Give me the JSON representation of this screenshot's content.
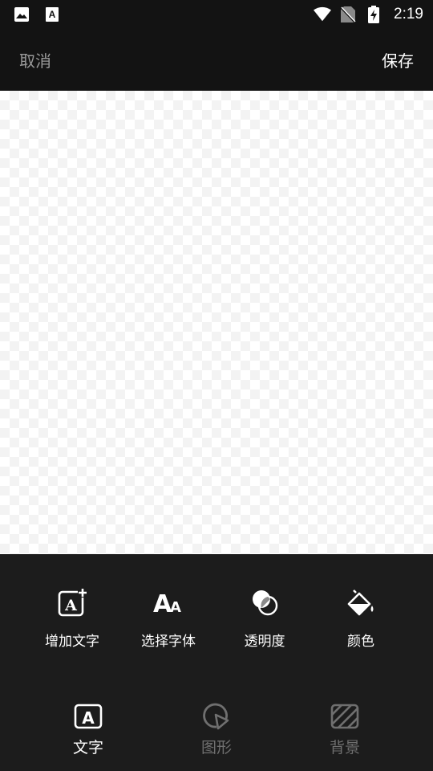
{
  "status_bar": {
    "time": "2:19",
    "icons": [
      "image-icon",
      "font-app-icon",
      "wifi-icon",
      "no-sim-icon",
      "battery-charging-icon"
    ]
  },
  "top_bar": {
    "cancel_label": "取消",
    "save_label": "保存"
  },
  "tools": [
    {
      "label": "增加文字",
      "icon": "add-text-icon"
    },
    {
      "label": "选择字体",
      "icon": "font-select-icon"
    },
    {
      "label": "透明度",
      "icon": "opacity-icon"
    },
    {
      "label": "颜色",
      "icon": "paint-bucket-icon"
    }
  ],
  "tabs": [
    {
      "label": "文字",
      "icon": "text-tab-icon",
      "active": true
    },
    {
      "label": "图形",
      "icon": "shape-tab-icon",
      "active": false
    },
    {
      "label": "背景",
      "icon": "background-tab-icon",
      "active": false
    }
  ],
  "colors": {
    "bar_background": "#131313",
    "panel_background": "#1c1c1c",
    "active_text": "#ffffff",
    "inactive_text": "#6f6f6f",
    "cancel_text": "#9a9a9a"
  }
}
